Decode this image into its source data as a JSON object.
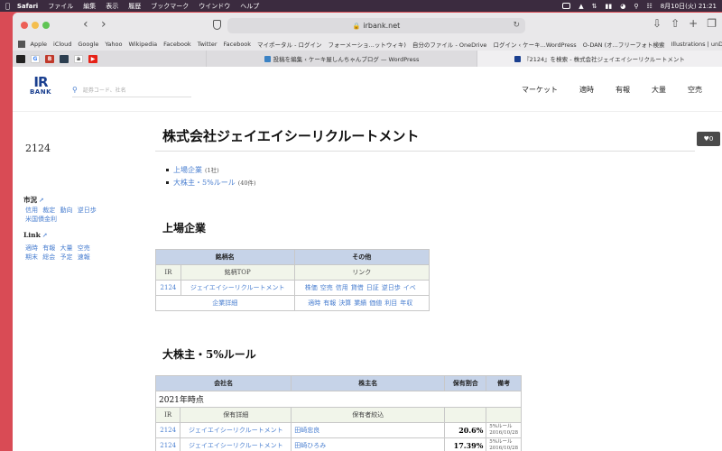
{
  "menubar": {
    "app": "Safari",
    "items": [
      "ファイル",
      "編集",
      "表示",
      "履歴",
      "ブックマーク",
      "ウインドウ",
      "ヘルプ"
    ],
    "clock": "8月10日(火) 21:21"
  },
  "browser": {
    "url": "irbank.net",
    "bookmarks": [
      "Apple",
      "iCloud",
      "Google",
      "Yahoo",
      "Wikipedia",
      "Facebook",
      "Twitter",
      "Facebook",
      "マイポータル - ログイン",
      "フォーメーショ...ットウィキ)",
      "自分のファイル - OneDrive",
      "ログイン ‹ ケーキ...WordPress",
      "O-DAN (オ...フリーフォト検索",
      "Illustrations | unDraw"
    ],
    "tabs": [
      {
        "label": "投稿を編集 ‹ ケーキ屋しんちゃんブログ — WordPress"
      },
      {
        "label": "『2124』を検索 - 株式会社ジェイエイシーリクルートメント"
      }
    ]
  },
  "site": {
    "logo_top": "IR",
    "logo_bottom": "BANK",
    "search_placeholder": "証券コード、社名",
    "nav": [
      "マーケット",
      "適時",
      "有報",
      "大量",
      "空売"
    ],
    "heart_count": "0"
  },
  "page": {
    "title": "株式会社ジェイエイシーリクルートメント",
    "code": "2124",
    "sidebar": {
      "market_heading": "市況",
      "market_links": [
        "信用",
        "裁定",
        "動向",
        "逆日歩",
        "米国債金利"
      ],
      "link_heading": "Link",
      "link_links": [
        "適時",
        "有報",
        "大量",
        "空売",
        "期末",
        "総会",
        "予定",
        "速報"
      ]
    },
    "bullets": [
      {
        "label": "上場企業",
        "count": "(1社)"
      },
      {
        "label": "大株主・5%ルール",
        "count": "(40件)"
      }
    ],
    "listed": {
      "heading": "上場企業",
      "headers": [
        "銘柄名",
        "その他"
      ],
      "sub": [
        "IR",
        "銘柄TOP",
        "リンク"
      ],
      "row": {
        "code": "2124",
        "name": "ジェイエイシーリクルートメント",
        "links": [
          "株価",
          "空売",
          "信用",
          "貸借",
          "日証",
          "逆日歩",
          "イベ"
        ]
      },
      "detail_label": "企業詳細",
      "detail_links": [
        "適時",
        "有報",
        "決算",
        "業績",
        "価値",
        "利目",
        "年収"
      ]
    },
    "holders": {
      "heading": "大株主・5%ルール",
      "headers": [
        "会社名",
        "株主名",
        "保有割合",
        "備考"
      ],
      "period": "2021年時点",
      "sub": [
        "IR",
        "保有詳細",
        "保有者絞込"
      ],
      "rows": [
        {
          "code": "2124",
          "company": "ジェイエイシーリクルートメント",
          "holder": "田崎忠良",
          "ratio": "20.6%",
          "note1": "5%ルール",
          "note2": "2016/10/28"
        },
        {
          "code": "2124",
          "company": "ジェイエイシーリクルートメント",
          "holder": "田崎ひろみ",
          "ratio": "17.39%",
          "note1": "5%ルール",
          "note2": "2016/10/28"
        }
      ]
    }
  }
}
